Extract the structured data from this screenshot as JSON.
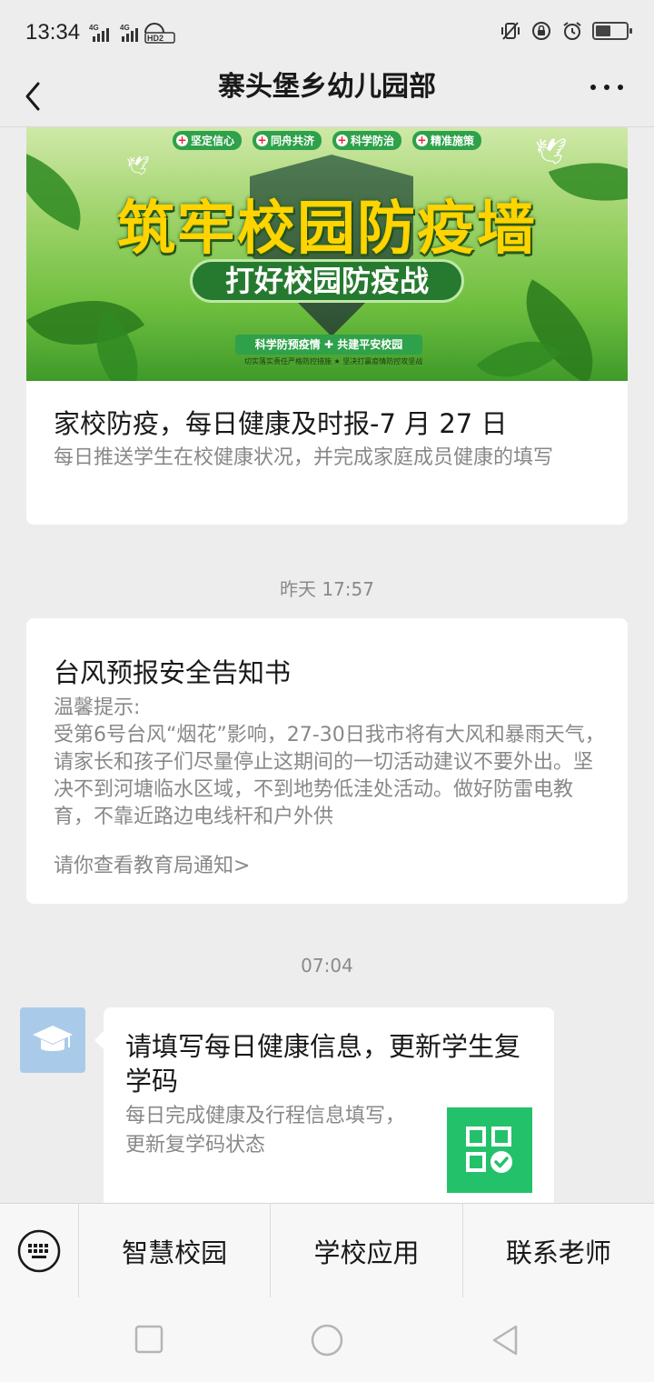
{
  "status_bar": {
    "time": "13:34",
    "network": "4G 4G HD2"
  },
  "navbar": {
    "title": "寨头堡乡幼儿园部"
  },
  "card1": {
    "banner": {
      "tags": [
        "坚定信心",
        "同舟共济",
        "科学防治",
        "精准施策"
      ],
      "headline": "筑牢校园防疫墙",
      "subline": "打好校园防疫战",
      "bottom": "科学防预疫情 ✚ 共建平安校园",
      "tiny": "切实落实责任严格防控措施 ★ 坚决打赢疫情防控攻坚战"
    },
    "title": "家校防疫，每日健康及时报-7 月 27 日",
    "desc": "每日推送学生在校健康状况，并完成家庭成员健康的填写"
  },
  "timestamp1": "昨天 17:57",
  "card2": {
    "title": "台风预报安全告知书",
    "body": "温馨提示:\n受第6号台风“烟花”影响，27-30日我市将有大风和暴雨天气，请家长和孩子们尽量停止这期间的一切活动建议不要外出。坚决不到河塘临水区域，不到地势低洼处活动。做好防雷电教育，不靠近路边电线杆和户外供",
    "link": "请你查看教育局通知>"
  },
  "timestamp2": "07:04",
  "message": {
    "avatar_icon": "graduation-cap-icon",
    "title": "请填写每日健康信息，更新学生复学码",
    "desc": "每日完成健康及行程信息填写，更新复学码状态",
    "tile_icon": "qr-check-icon",
    "tile_color": "#24c16b"
  },
  "bottom_menu": {
    "items": [
      "智慧校园",
      "学校应用",
      "联系老师"
    ]
  },
  "colors": {
    "background": "#ededed",
    "card": "#ffffff",
    "accent_green": "#24c16b"
  }
}
